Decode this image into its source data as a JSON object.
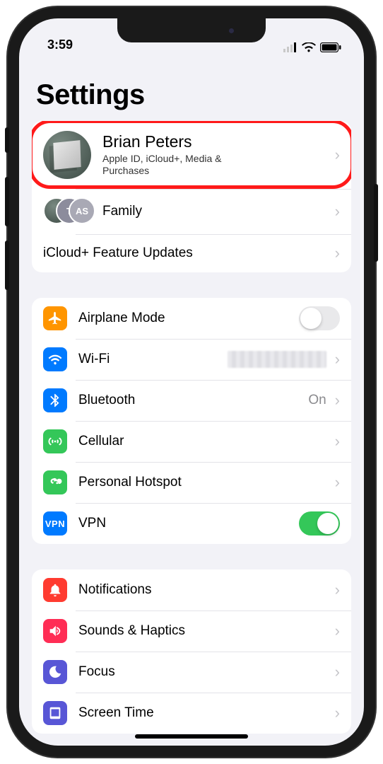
{
  "status": {
    "time": "3:59"
  },
  "title": "Settings",
  "profile": {
    "name": "Brian Peters",
    "subtitle": "Apple ID, iCloud+, Media & Purchases"
  },
  "family": {
    "label": "Family",
    "badge1": "T",
    "badge2": "AS"
  },
  "updates": {
    "label": "iCloud+ Feature Updates"
  },
  "net": {
    "airplane": {
      "label": "Airplane Mode"
    },
    "wifi": {
      "label": "Wi-Fi",
      "value": ""
    },
    "bt": {
      "label": "Bluetooth",
      "value": "On"
    },
    "cell": {
      "label": "Cellular"
    },
    "hotspot": {
      "label": "Personal Hotspot"
    },
    "vpn": {
      "label": "VPN",
      "badge": "VPN"
    }
  },
  "general": {
    "notif": {
      "label": "Notifications"
    },
    "sounds": {
      "label": "Sounds & Haptics"
    },
    "focus": {
      "label": "Focus"
    },
    "screen": {
      "label": "Screen Time"
    }
  },
  "colors": {
    "orange": "#ff9500",
    "blue": "#007aff",
    "green": "#34c759",
    "darkgreen": "#30b14c",
    "red": "#ff3b30",
    "pink": "#ff2d55",
    "indigo": "#5856d6"
  }
}
